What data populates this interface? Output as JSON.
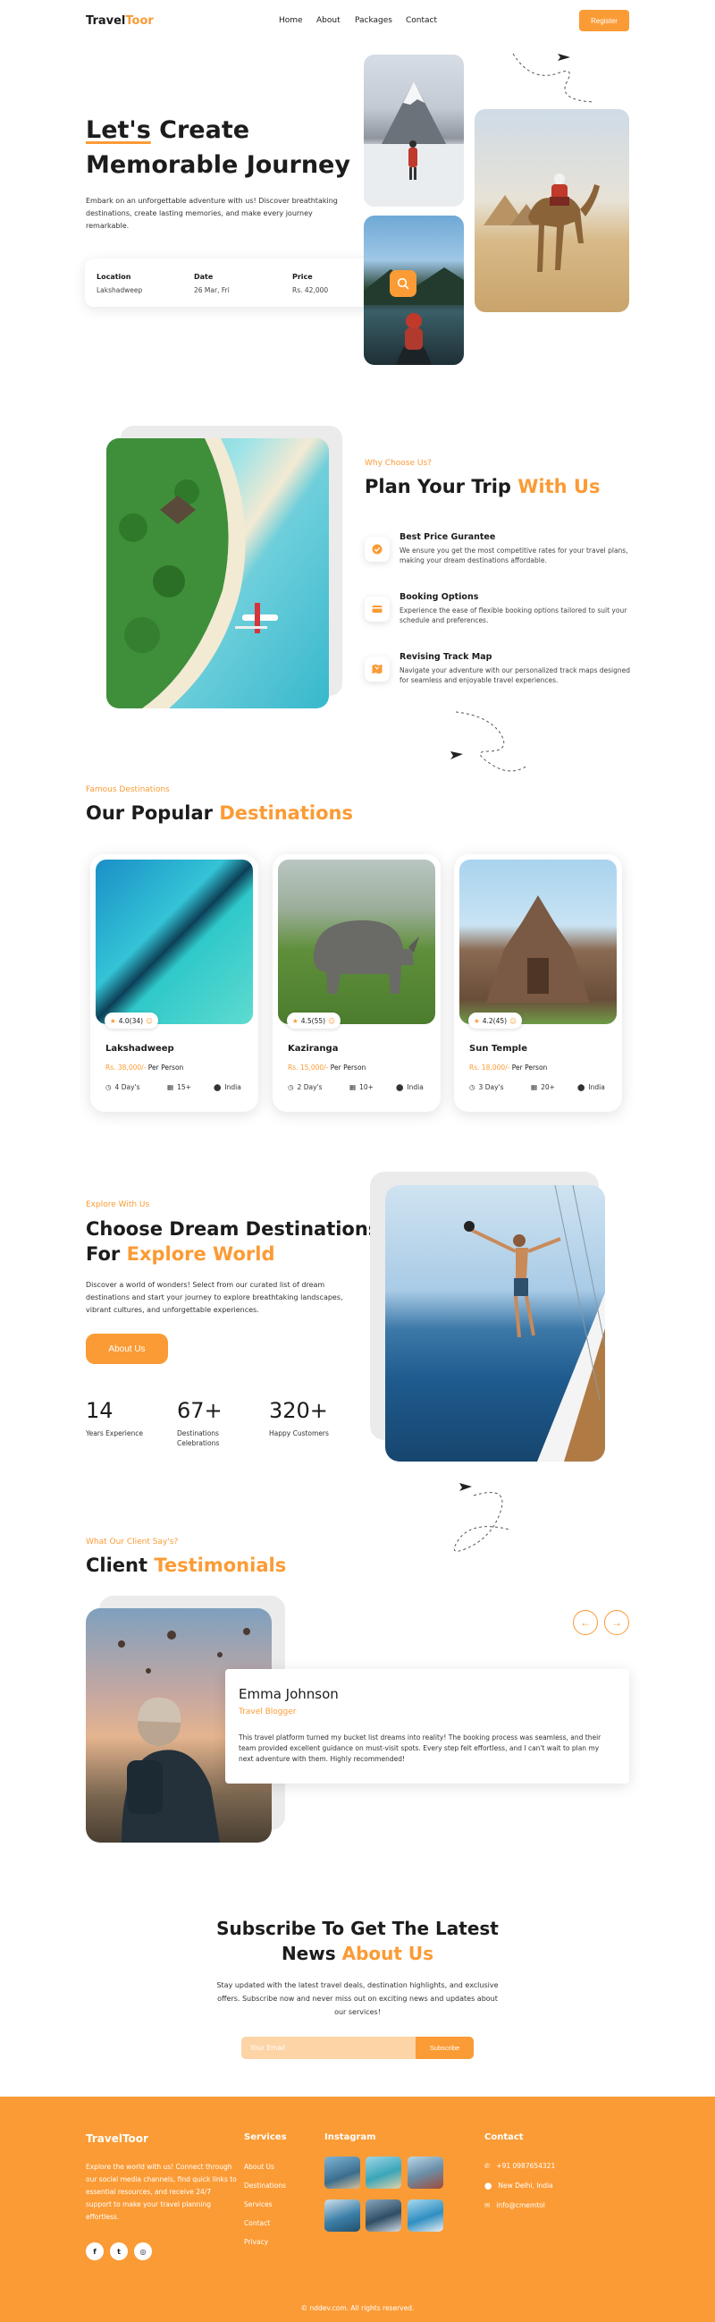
{
  "nav": {
    "logo_dark": "Travel",
    "logo_orange": "Toor",
    "links": [
      "Home",
      "About",
      "Packages",
      "Contact"
    ],
    "register": "Register"
  },
  "hero": {
    "title_underlined": "Let's",
    "title_line1_rest": " Create",
    "title_line2": "Memorable Journey",
    "description": "Embark on an unforgettable adventure with us! Discover breathtaking destinations, create lasting memories, and make every journey remarkable.",
    "search": {
      "location_label": "Location",
      "location_value": "Lakshadweep",
      "date_label": "Date",
      "date_value": "26 Mar, Fri",
      "price_label": "Price",
      "price_value": "Rs. 42,000"
    }
  },
  "why": {
    "subtitle": "Why Choose Us?",
    "title_dark": "Plan Your Trip ",
    "title_orange": "With Us",
    "features": [
      {
        "title": "Best Price Gurantee",
        "desc": "We ensure you get the most competitive rates for your travel plans, making your dream destinations affordable."
      },
      {
        "title": "Booking Options",
        "desc": "Experience the ease of flexible booking options tailored to suit your schedule and preferences."
      },
      {
        "title": "Revising Track Map",
        "desc": "Navigate your adventure with our personalized track maps designed for seamless and enjoyable travel experiences."
      }
    ]
  },
  "destinations": {
    "subtitle": "Famous Destinations",
    "title_dark": "Our Popular ",
    "title_orange": "Destinations",
    "cards": [
      {
        "name": "Lakshadweep",
        "rating": "4.0(34)",
        "price": "Rs. 38,000/-",
        "per": " Per Person",
        "days": "4 Day's",
        "people": "15+",
        "location": "India"
      },
      {
        "name": "Kaziranga",
        "rating": "4.5(55)",
        "price": "Rs. 15,000/-",
        "per": " Per Person",
        "days": "2 Day's",
        "people": "10+",
        "location": "India"
      },
      {
        "name": "Sun Temple",
        "rating": "4.2(45)",
        "price": "Rs. 18,000/-",
        "per": " Per Person",
        "days": "3 Day's",
        "people": "20+",
        "location": "India"
      }
    ]
  },
  "explore": {
    "subtitle": "Explore With Us",
    "title_line1": "Choose Dream Destinations",
    "title_line2_dark": "For ",
    "title_line2_orange": "Explore World",
    "description": "Discover a world of wonders! Select from our curated list of dream destinations and start your journey to explore breathtaking landscapes, vibrant cultures, and unforgettable experiences.",
    "button": "About Us",
    "stats": [
      {
        "num": "14",
        "label": "Years Experience"
      },
      {
        "num": "67+",
        "label": "Destinations Celebrations"
      },
      {
        "num": "320+",
        "label": "Happy Customers"
      }
    ]
  },
  "testimonials": {
    "subtitle": "What Our Client Say's?",
    "title_dark": "Client ",
    "title_orange": "Testimonials",
    "prev": "←",
    "next": "→",
    "name": "Emma Johnson",
    "role": "Travel Blogger",
    "quote": "This travel platform turned my bucket list dreams into reality! The booking process was seamless, and their team provided excellent guidance on must-visit spots. Every step felt effortless, and I can't wait to plan my next adventure with them. Highly recommended!"
  },
  "subscribe": {
    "title_line1": "Subscribe To Get The Latest",
    "title_line2_dark": "News ",
    "title_line2_orange": "About Us",
    "description": "Stay updated with the latest travel deals, destination highlights, and exclusive offers. Subscribe now and never miss out on exciting news and updates about our services!",
    "placeholder": "Your Email",
    "button": "Subscribe"
  },
  "footer": {
    "logo": "TravelToor",
    "description": "Explore the world with us! Connect through our social media channels, find quick links to essential resources, and receive 24/7 support to make your travel planning effortless.",
    "social": [
      "f",
      "t",
      "◎"
    ],
    "services_heading": "Services",
    "services": [
      "About Us",
      "Destinations",
      "Services",
      "Contact",
      "Privacy"
    ],
    "instagram_heading": "Instagram",
    "contact_heading": "Contact",
    "phone": "+91 0987654321",
    "address": "New Delhi, India",
    "email": "info@cmemtol",
    "copyright": "© nddev.com. All rights reserved."
  },
  "colors": {
    "accent": "#fb9b35",
    "text": "#1c1c1c"
  }
}
